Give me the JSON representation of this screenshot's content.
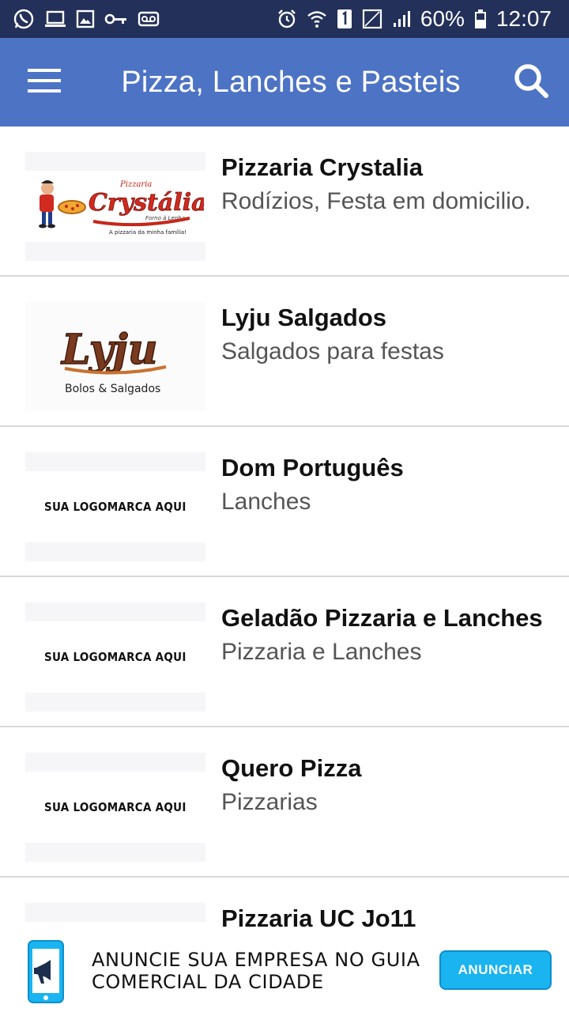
{
  "status_bar": {
    "battery": "60%",
    "time": "12:07",
    "icons_left": [
      "whatsapp-icon",
      "laptop-icon",
      "image-icon",
      "key-icon",
      "voicemail-icon"
    ],
    "icons_right": [
      "alarm-icon",
      "wifi-icon",
      "sim-1-icon",
      "no-signal-icon",
      "signal-icon",
      "battery-icon"
    ]
  },
  "app_bar": {
    "title": "Pizza, Lanches e Pasteis",
    "menu_icon": "hamburger-menu-icon",
    "search_icon": "search-icon",
    "background": "#4d73c4"
  },
  "placeholder_logo_text": "SUA LOGOMARCA AQUI",
  "items": [
    {
      "name": "Pizzaria Crystalia",
      "description": "Rodízios, Festa em domicilio.",
      "logo": {
        "brand": "Pizzaria",
        "word": "Crystália",
        "sub": "Forno à Lenha",
        "tagline": "A pizzaria da minha família!"
      }
    },
    {
      "name": "Lyju Salgados",
      "description": "Salgados para festas",
      "logo": {
        "word": "Lyju",
        "sub": "Bolos & Salgados"
      }
    },
    {
      "name": "Dom Português",
      "description": "Lanches"
    },
    {
      "name": "Geladão Pizzaria e Lanches",
      "description": "Pizzaria e Lanches"
    },
    {
      "name": "Quero Pizza",
      "description": "Pizzarias"
    },
    {
      "name": "Pizzaria UC Jo11",
      "description": ""
    }
  ],
  "banner": {
    "text": "ANUNCIE SUA EMPRESA NO GUIA COMERCIAL DA CIDADE",
    "button_label": "ANUNCIAR",
    "accent": "#1ab4f0"
  }
}
